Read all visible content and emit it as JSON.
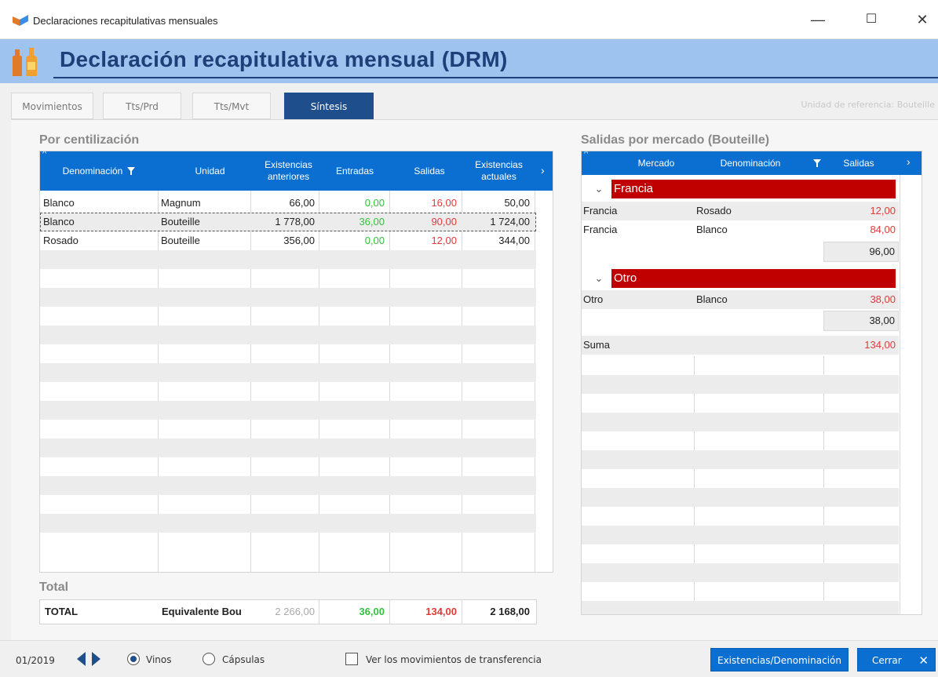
{
  "window": {
    "title": "Declaraciones recapitulativas mensuales",
    "minimize": "—",
    "maximize": "☐",
    "close": "✕"
  },
  "header": {
    "title": "Declaración recapitulativa mensual (DRM)"
  },
  "tabs": [
    {
      "label": "Movimientos",
      "active": false
    },
    {
      "label": "Tts/Prd",
      "active": false
    },
    {
      "label": "Tts/Mvt",
      "active": false
    },
    {
      "label": "Síntesis",
      "active": true
    }
  ],
  "unit_reference": "Unidad de referencia: Bouteille",
  "left": {
    "section_title": "Por centilización",
    "columns": {
      "denominacion": "Denominación",
      "unidad": "Unidad",
      "exist_ant_1": "Existencias",
      "exist_ant_2": "anteriores",
      "entradas": "Entradas",
      "salidas": "Salidas",
      "exist_act_1": "Existencias",
      "exist_act_2": "actuales"
    },
    "rows": [
      {
        "denominacion": "Blanco",
        "unidad": "Magnum",
        "exist_ant": "66,00",
        "entradas": "0,00",
        "salidas": "16,00",
        "exist_act": "50,00"
      },
      {
        "denominacion": "Blanco",
        "unidad": "Bouteille",
        "exist_ant": "1 778,00",
        "entradas": "36,00",
        "salidas": "90,00",
        "exist_act": "1 724,00"
      },
      {
        "denominacion": "Rosado",
        "unidad": "Bouteille",
        "exist_ant": "356,00",
        "entradas": "0,00",
        "salidas": "12,00",
        "exist_act": "344,00"
      }
    ],
    "total_title": "Total",
    "total": {
      "label": "TOTAL",
      "unidad": "Equivalente Bou",
      "exist_ant": "2 266,00",
      "entradas": "36,00",
      "salidas": "134,00",
      "exist_act": "2 168,00"
    }
  },
  "right": {
    "section_title": "Salidas por mercado (Bouteille)",
    "columns": {
      "mercado": "Mercado",
      "denominacion": "Denominación",
      "salidas": "Salidas"
    },
    "groups": [
      {
        "name": "Francia",
        "rows": [
          {
            "mercado": "Francia",
            "denominacion": "Rosado",
            "salidas": "12,00"
          },
          {
            "mercado": "Francia",
            "denominacion": "Blanco",
            "salidas": "84,00"
          }
        ],
        "subtotal": "96,00"
      },
      {
        "name": "Otro",
        "rows": [
          {
            "mercado": "Otro",
            "denominacion": "Blanco",
            "salidas": "38,00"
          }
        ],
        "subtotal": "38,00"
      }
    ],
    "sum_label": "Suma",
    "sum_value": "134,00"
  },
  "footer": {
    "period": "01/2019",
    "radio_vinos": "Vinos",
    "radio_capsulas": "Cápsulas",
    "checkbox_label": "Ver los movimientos de transferencia",
    "btn_existencias": "Existencias/Denominación",
    "btn_cerrar": "Cerrar",
    "selected_radio": "Vinos",
    "checkbox_checked": false
  },
  "colors": {
    "header_band": "#9dc3ee",
    "header_text": "#1f3f7a",
    "grid_header": "#0a6fd0",
    "active_tab": "#1f4e8c",
    "group_band": "#c00000",
    "positive": "#35c23f",
    "negative": "#e03a3a"
  }
}
